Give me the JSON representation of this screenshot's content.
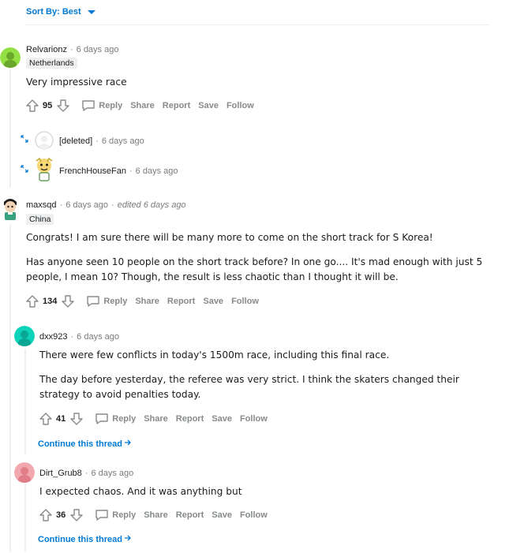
{
  "sort": {
    "label": "Sort By: Best"
  },
  "actions": {
    "reply": "Reply",
    "share": "Share",
    "report": "Report",
    "save": "Save",
    "follow": "Follow"
  },
  "comments": [
    {
      "user": "Relvarionz",
      "time": "6 days ago",
      "flair": "Netherlands",
      "body": [
        "Very impressive race"
      ],
      "votes": "95"
    },
    {
      "user": "[deleted]",
      "time": "6 days ago"
    },
    {
      "user": "FrenchHouseFan",
      "time": "6 days ago"
    },
    {
      "user": "maxsqd",
      "time": "6 days ago",
      "edited": "edited 6 days ago",
      "flair": "China",
      "body": [
        "Congrats! I am sure there will be many more to come on the short track for S Korea!",
        "Has anyone seen 10 people on the short track before? In one go.... It's mad enough with just 5 people, I mean 10? Though, the result is less chaotic than I thought it will be."
      ],
      "votes": "134"
    },
    {
      "user": "dxx923",
      "time": "6 days ago",
      "body": [
        "There were few conflicts in today's 1500m race, including this final race.",
        "The day before yesterday, the referee was very strict. I think the skaters changed their strategy to avoid penalties today."
      ],
      "votes": "41",
      "continue": "Continue this thread"
    },
    {
      "user": "Dirt_Grub8",
      "time": "6 days ago",
      "body": [
        "I expected chaos. And it was anything but"
      ],
      "votes": "36",
      "continue": "Continue this thread"
    }
  ],
  "colors": {
    "accent": "#0079d3",
    "muted": "#878a8c",
    "line": "#edeff1"
  }
}
